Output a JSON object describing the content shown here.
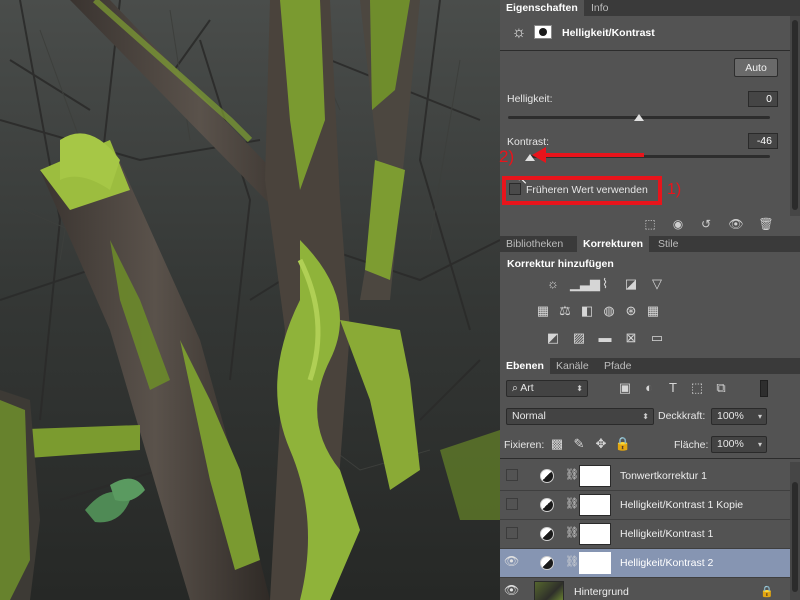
{
  "properties": {
    "tabs": [
      {
        "label": "Eigenschaften"
      },
      {
        "label": "Info"
      }
    ],
    "adjustment_title": "Helligkeit/Kontrast",
    "auto_label": "Auto",
    "brightness": {
      "label": "Helligkeit:",
      "value": "0",
      "slider_fraction": 0.5
    },
    "contrast": {
      "label": "Kontrast:",
      "value": "-46",
      "slider_fraction": 0.0
    },
    "legacy_checkbox_label": "Früheren Wert verwenden",
    "annotation_1": "1)",
    "annotation_2": "2)"
  },
  "adjustments": {
    "tabs": [
      {
        "label": "Bibliotheken"
      },
      {
        "label": "Korrekturen"
      },
      {
        "label": "Stile"
      }
    ],
    "heading": "Korrektur hinzufügen",
    "rows": [
      [
        "brightness-icon",
        "levels-icon",
        "curves-icon",
        "exposure-icon",
        "vibrance-icon"
      ],
      [
        "hue-saturation-icon",
        "color-balance-icon",
        "black-white-icon",
        "photo-filter-icon",
        "channel-mixer-icon",
        "color-lookup-icon"
      ],
      [
        "invert-icon",
        "posterize-icon",
        "threshold-icon",
        "selective-color-icon",
        "gradient-map-icon"
      ]
    ]
  },
  "layers_panel": {
    "tabs": [
      {
        "label": "Ebenen"
      },
      {
        "label": "Kanäle"
      },
      {
        "label": "Pfade"
      }
    ],
    "filter_kind": "Art",
    "blend_mode": "Normal",
    "opacity_label": "Deckkraft:",
    "opacity_value": "100%",
    "lock_label": "Fixieren:",
    "fill_label": "Fläche:",
    "fill_value": "100%",
    "layers": [
      {
        "name": "Tonwertkorrektur 1",
        "visible": false,
        "selected": false
      },
      {
        "name": "Helligkeit/Kontrast 1 Kopie",
        "visible": false,
        "selected": false
      },
      {
        "name": "Helligkeit/Kontrast 1",
        "visible": false,
        "selected": false
      },
      {
        "name": "Helligkeit/Kontrast 2",
        "visible": true,
        "selected": true
      },
      {
        "name": "Hintergrund",
        "visible": true,
        "selected": false
      }
    ]
  },
  "colors": {
    "panel_bg": "#535353",
    "selected_layer": "#8695b2",
    "highlight_red": "#e8141b",
    "moss": "#8fb33a"
  }
}
